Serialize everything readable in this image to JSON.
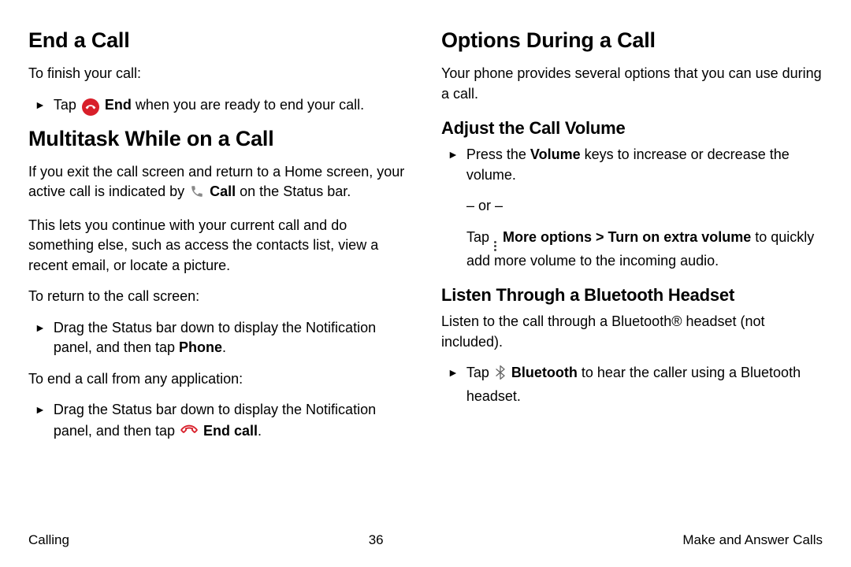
{
  "left": {
    "h_end": "End a Call",
    "p_finish": "To finish your call:",
    "tap1_pre": "Tap ",
    "tap1_bold": "End",
    "tap1_post": " when you are ready to end your call.",
    "h_multitask": "Multitask While on a Call",
    "p_multi1_pre": "If you exit the call screen and return to a Home screen, your active call is indicated by ",
    "p_multi1_bold": "Call",
    "p_multi1_post": " on the Status bar.",
    "p_multi2": "This lets you continue with your current call and do something else, such as access the contacts list, view a recent email, or locate a picture.",
    "p_return": "To return to the call screen:",
    "b_return_pre": "Drag the Status bar down to display the Notification panel, and then tap ",
    "b_return_bold": "Phone",
    "b_return_post": ".",
    "p_endany": "To end a call from any application:",
    "b_endany_pre": "Drag the Status bar down to display the Notification panel, and then tap ",
    "b_endany_bold": "End call",
    "b_endany_post": "."
  },
  "right": {
    "h_options": "Options During a Call",
    "p_options": "Your phone provides several options that you can use during a call.",
    "h_adjust": "Adjust the Call Volume",
    "b_vol_pre": "Press the ",
    "b_vol_bold": "Volume",
    "b_vol_post": " keys to increase or decrease the volume.",
    "or": "– or –",
    "b_more_pre": "Tap ",
    "b_more_bold": "More options > Turn on extra volume",
    "b_more_post": " to quickly add more volume to the incoming audio.",
    "h_bt": "Listen Through a Bluetooth Headset",
    "p_bt": "Listen to the call through a Bluetooth® headset (not included).",
    "b_bt_pre": "Tap ",
    "b_bt_bold": "Bluetooth",
    "b_bt_post": " to hear the caller using a Bluetooth headset."
  },
  "footer": {
    "left": "Calling",
    "center": "36",
    "right": "Make and Answer Calls"
  }
}
